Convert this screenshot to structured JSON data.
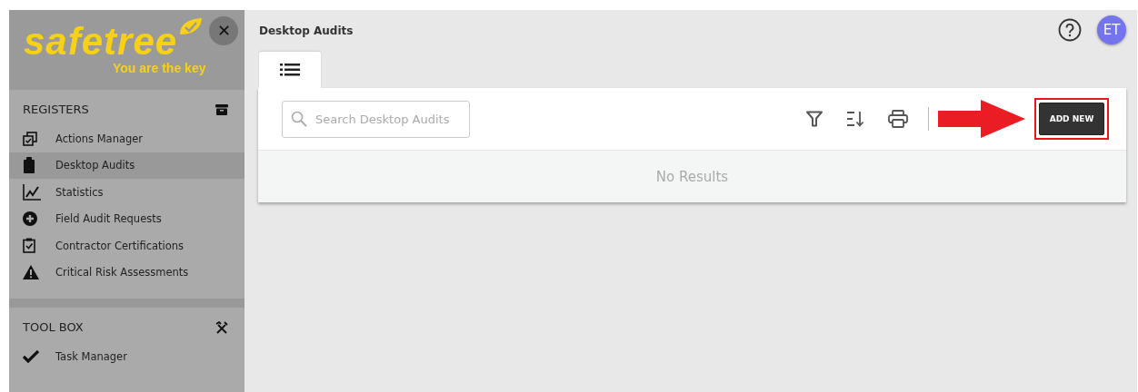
{
  "sidebar": {
    "close_button": "✕",
    "logo": {
      "name": "safetree",
      "tagline": "You are the key"
    },
    "sections": [
      {
        "title": "REGISTERS",
        "kind": "registers",
        "items": [
          {
            "label": "Actions Manager",
            "selected": false
          },
          {
            "label": "Desktop Audits",
            "selected": true
          },
          {
            "label": "Statistics",
            "selected": false
          },
          {
            "label": "Field Audit Requests",
            "selected": false
          },
          {
            "label": "Contractor Certifications",
            "selected": false
          },
          {
            "label": "Critical Risk Assessments",
            "selected": false
          }
        ]
      },
      {
        "title": "TOOL BOX",
        "kind": "toolbox",
        "items": [
          {
            "label": "Task Manager",
            "selected": false
          }
        ]
      }
    ]
  },
  "page": {
    "title": "Desktop Audits",
    "avatar": "ET",
    "tabs": [
      {
        "selected": true
      }
    ],
    "search": {
      "placeholder": "Search Desktop Audits"
    },
    "add_button": "ADD NEW",
    "empty_message": "No Results"
  }
}
